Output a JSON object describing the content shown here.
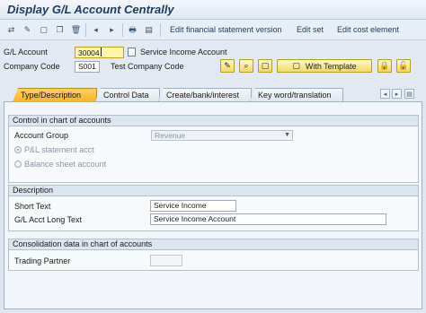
{
  "window": {
    "title": "Display G/L Account Centrally"
  },
  "toolbar": {
    "links": [
      "Edit financial statement version",
      "Edit set",
      "Edit cost element"
    ]
  },
  "header": {
    "gl_account_label": "G/L Account",
    "gl_account_value": "30004",
    "gl_account_desc": "Service Income Account",
    "company_code_label": "Company Code",
    "company_code_value": "S001",
    "company_code_desc": "Test Company Code",
    "with_template_label": "With Template"
  },
  "tabs": [
    {
      "label": "Type/Description",
      "active": true
    },
    {
      "label": "Control Data",
      "active": false
    },
    {
      "label": "Create/bank/interest",
      "active": false
    },
    {
      "label": "Key word/translation",
      "active": false
    }
  ],
  "sections": {
    "control": {
      "title": "Control in chart of accounts",
      "account_group_label": "Account Group",
      "account_group_value": "Revenue",
      "pl_label": "P&L statement acct",
      "bs_label": "Balance sheet account"
    },
    "description": {
      "title": "Description",
      "short_text_label": "Short Text",
      "short_text_value": "Service Income",
      "long_text_label": "G/L Acct Long Text",
      "long_text_value": "Service Income Account"
    },
    "consolidation": {
      "title": "Consolidation data in chart of accounts",
      "trading_partner_label": "Trading Partner",
      "trading_partner_value": ""
    }
  },
  "colors": {
    "active_tab": "#f4b32a",
    "button_yellow": "#f2d96b",
    "field_active": "#fff6a8"
  }
}
